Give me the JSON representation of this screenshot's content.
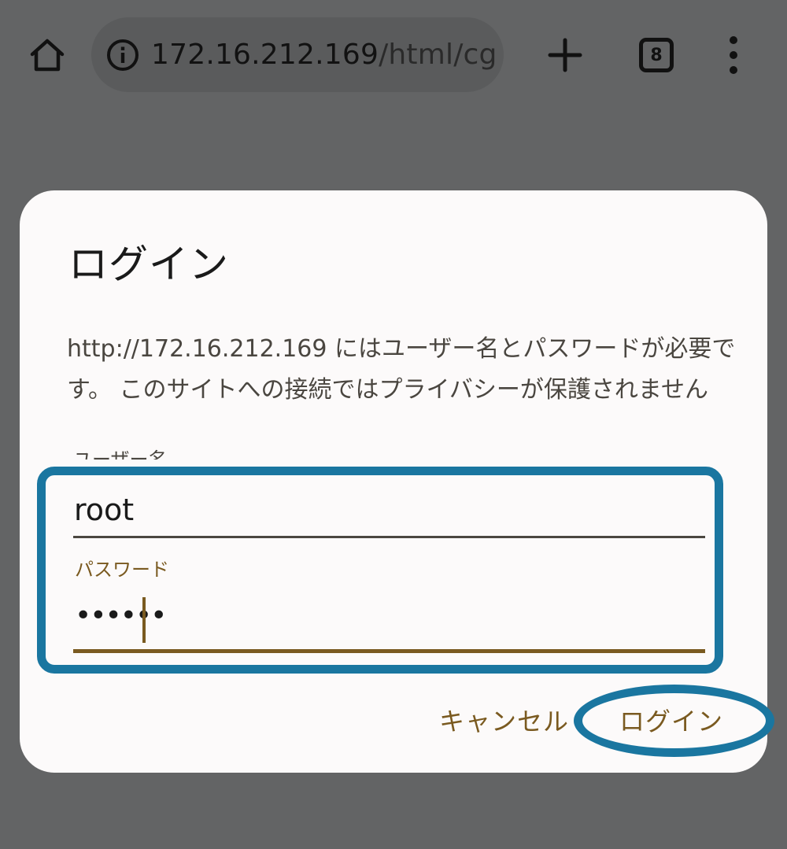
{
  "browser": {
    "url_host": "172.16.212.169",
    "url_path": "/html/cg",
    "tab_count": "8"
  },
  "dialog": {
    "title": "ログイン",
    "message": "http://172.16.212.169 にはユーザー名とパスワードが必要です。 このサイトへの接続ではプライバシーが保護されません",
    "username_label": "ユーザー名",
    "username_value": "root",
    "password_label": "パスワード",
    "password_value": "••••••",
    "cancel_label": "キャンセル",
    "login_label": "ログイン"
  },
  "colors": {
    "accent": "#7a5a20",
    "highlight": "#1a76a0",
    "backdrop": "#636465"
  }
}
